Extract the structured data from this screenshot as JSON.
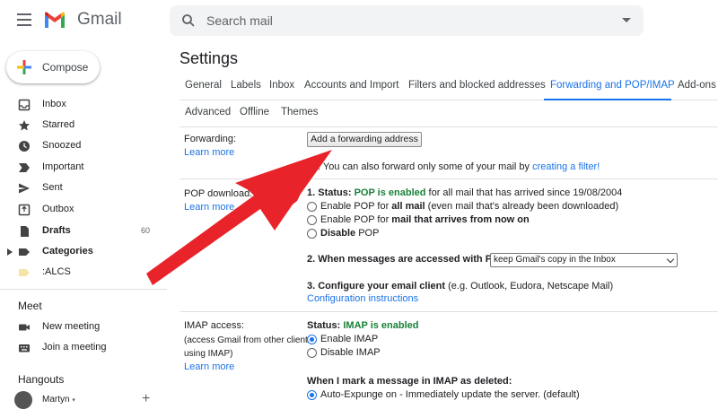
{
  "header": {
    "brand": "Gmail",
    "search_placeholder": "Search mail"
  },
  "sidebar": {
    "compose": "Compose",
    "items": [
      {
        "label": "Inbox",
        "icon": "inbox-icon",
        "count": ""
      },
      {
        "label": "Starred",
        "icon": "star-icon",
        "count": ""
      },
      {
        "label": "Snoozed",
        "icon": "clock-icon",
        "count": ""
      },
      {
        "label": "Important",
        "icon": "important-icon",
        "count": ""
      },
      {
        "label": "Sent",
        "icon": "send-icon",
        "count": ""
      },
      {
        "label": "Outbox",
        "icon": "outbox-icon",
        "count": ""
      },
      {
        "label": "Drafts",
        "icon": "draft-icon",
        "count": "60"
      },
      {
        "label": "Categories",
        "icon": "label-icon",
        "count": ""
      },
      {
        "label": ":ALCS",
        "icon": "label-icon",
        "count": ""
      }
    ],
    "meet": {
      "heading": "Meet",
      "new_meeting": "New meeting",
      "join": "Join a meeting"
    },
    "hangouts": {
      "heading": "Hangouts",
      "user": "Martyn"
    }
  },
  "main": {
    "title": "Settings",
    "tabs": [
      "General",
      "Labels",
      "Inbox",
      "Accounts and Import",
      "Filters and blocked addresses",
      "Forwarding and POP/IMAP",
      "Add-ons"
    ],
    "tabs_row2": [
      "Advanced",
      "Offline",
      "Themes"
    ],
    "forwarding": {
      "label": "Forwarding:",
      "learn_more": "Learn more",
      "button": "Add a forwarding address",
      "tip_prefix": ": You can also forward only some of your mail by ",
      "tip_link": "creating a filter!"
    },
    "pop": {
      "label": "POP download:",
      "learn_more": "Learn more",
      "status_prefix": "1. Status: ",
      "status_value": "POP is enabled",
      "status_suffix": " for all mail that has arrived since 19/08/2004",
      "opt1_a": "Enable POP for ",
      "opt1_b": "all mail",
      "opt1_c": " (even mail that's already been downloaded)",
      "opt2_a": "Enable POP for ",
      "opt2_b": "mail that arrives from now on",
      "opt3_a": "Disable",
      "opt3_b": " POP",
      "when_label": "2. When messages are accessed with POP",
      "when_value": "keep Gmail's copy in the Inbox",
      "configure_a": "3. Configure your email client",
      "configure_b": " (e.g. Outlook, Eudora, Netscape Mail)",
      "configure_link": "Configuration instructions"
    },
    "imap": {
      "label": "IMAP access:",
      "note1": "(access Gmail from other clients",
      "note2": "using IMAP)",
      "learn_more": "Learn more",
      "status_prefix": "Status: ",
      "status_value": "IMAP is enabled",
      "enable": "Enable IMAP",
      "disable": "Disable IMAP",
      "deleted_label": "When I mark a message in IMAP as deleted:",
      "expunge": "Auto-Expunge on - Immediately update the server. (default)"
    }
  },
  "colors": {
    "accent": "#1a73e8",
    "arrow": "#e8232a",
    "status_green": "#188038"
  }
}
